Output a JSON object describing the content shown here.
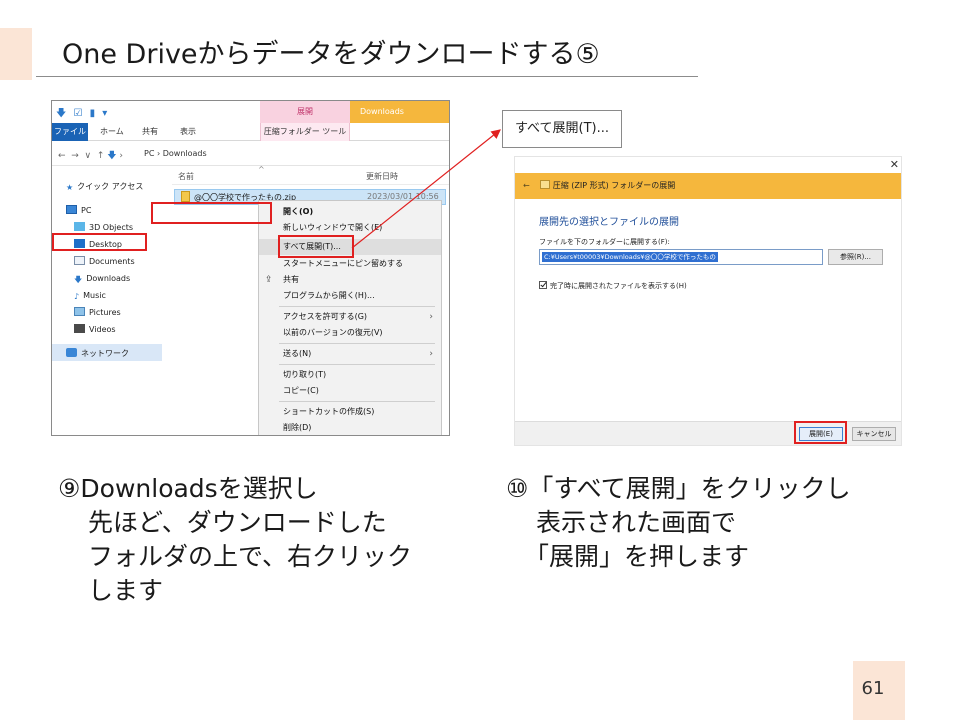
{
  "slide": {
    "title": "One Driveからデータをダウンロードする⑤",
    "page_number": "61"
  },
  "explorer": {
    "context_tab": "展開",
    "window_title": "Downloads",
    "ribbon_tabs": [
      "ファイル",
      "ホーム",
      "共有",
      "表示",
      "圧縮フォルダー ツール"
    ],
    "path": [
      "PC",
      "Downloads"
    ],
    "columns": {
      "name": "名前",
      "date": "更新日時"
    },
    "sidebar": [
      {
        "label": "クイック アクセス",
        "icon": "star-icon"
      },
      {
        "label": "PC",
        "icon": "computer-icon"
      },
      {
        "label": "3D Objects",
        "icon": "cube-icon"
      },
      {
        "label": "Desktop",
        "icon": "desktop-icon"
      },
      {
        "label": "Documents",
        "icon": "document-icon"
      },
      {
        "label": "Downloads",
        "icon": "download-icon"
      },
      {
        "label": "Music",
        "icon": "music-icon"
      },
      {
        "label": "Pictures",
        "icon": "picture-icon"
      },
      {
        "label": "Videos",
        "icon": "video-icon"
      },
      {
        "label": "ネットワーク",
        "icon": "network-icon"
      }
    ],
    "file": {
      "name": "@〇〇学校で作ったもの.zip",
      "date": "2023/03/01 10:56"
    },
    "context_menu": [
      "開く(O)",
      "新しいウィンドウで開く(E)",
      "すべて展開(T)...",
      "スタートメニューにピン留めする",
      "共有",
      "プログラムから開く(H)...",
      "アクセスを許可する(G)",
      "以前のバージョンの復元(V)",
      "送る(N)",
      "切り取り(T)",
      "コピー(C)",
      "ショートカットの作成(S)",
      "削除(D)"
    ]
  },
  "callout": {
    "label": "すべて展開(T)..."
  },
  "dialog": {
    "title": "圧縮 (ZIP 形式) フォルダーの展開",
    "heading": "展開先の選択とファイルの展開",
    "field_label": "ファイルを下のフォルダーに展開する(F):",
    "path_value": "C:¥Users¥t00003¥Downloads¥@〇〇学校で作ったもの",
    "browse_label": "参照(R)...",
    "checkbox_label": "完了時に展開されたファイルを表示する(H)",
    "extract_label": "展開(E)",
    "cancel_label": "キャンセル"
  },
  "descriptions": {
    "left": [
      "⑨Downloadsを選択し",
      "先ほど、ダウンロードした",
      "フォルダの上で、右クリック",
      "します"
    ],
    "right": [
      "⑩「すべて展開」をクリックし",
      "表示された画面で",
      "「展開」を押します"
    ]
  },
  "colors": {
    "accent_peach": "#fbe5d6",
    "highlight_red": "#e02020",
    "ribbon_yellow": "#f5b73d",
    "heading_blue": "#1f4e99"
  }
}
